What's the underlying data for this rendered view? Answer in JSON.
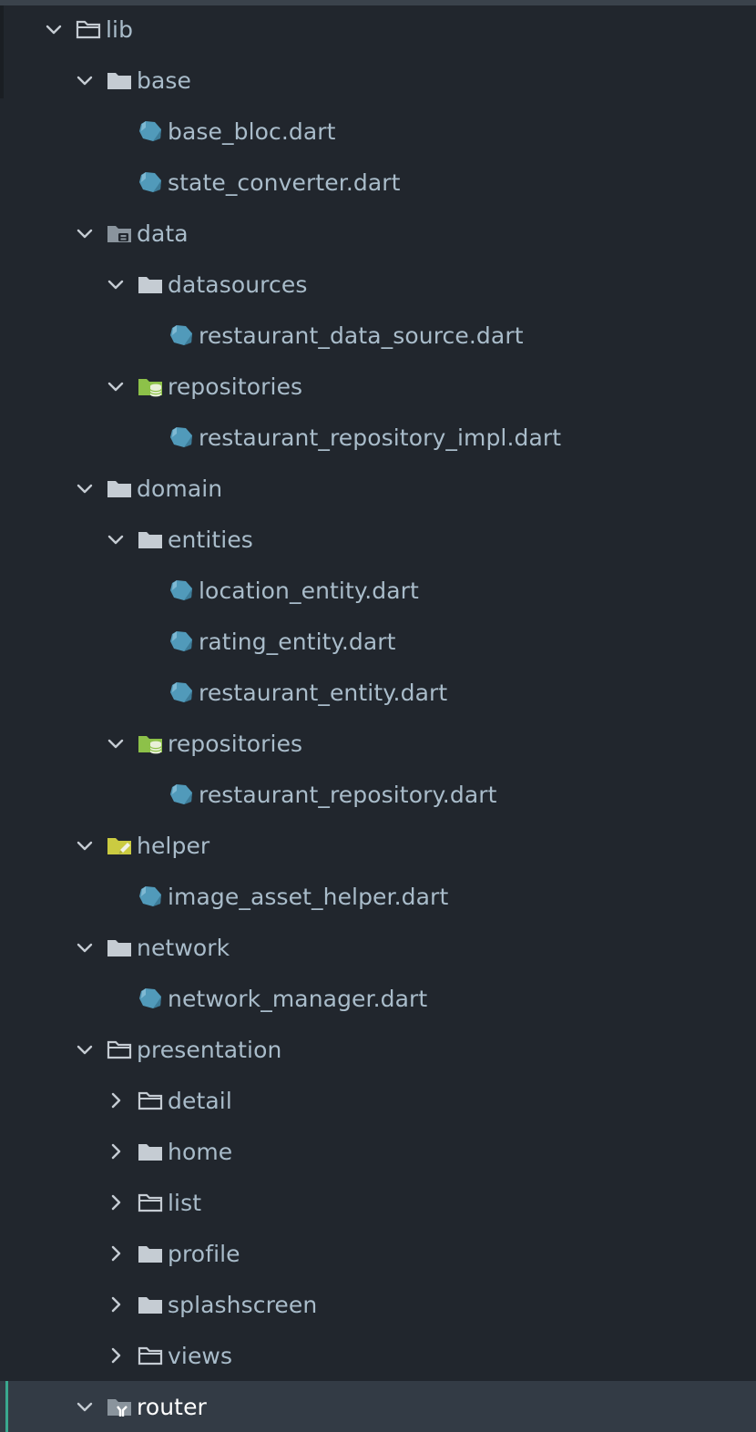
{
  "tree": [
    {
      "label": "lib",
      "depth": 0,
      "kind": "folder-outline",
      "expanded": true,
      "name": "tree-item-lib"
    },
    {
      "label": "base",
      "depth": 1,
      "kind": "folder",
      "expanded": true,
      "name": "tree-item-base"
    },
    {
      "label": "base_bloc.dart",
      "depth": 2,
      "kind": "dart-file",
      "name": "tree-item-base-bloc"
    },
    {
      "label": "state_converter.dart",
      "depth": 2,
      "kind": "dart-file",
      "name": "tree-item-state-converter"
    },
    {
      "label": "data",
      "depth": 1,
      "kind": "folder-data",
      "expanded": true,
      "name": "tree-item-data"
    },
    {
      "label": "datasources",
      "depth": 2,
      "kind": "folder",
      "expanded": true,
      "name": "tree-item-datasources"
    },
    {
      "label": "restaurant_data_source.dart",
      "depth": 3,
      "kind": "dart-file",
      "name": "tree-item-restaurant-data-source"
    },
    {
      "label": "repositories",
      "depth": 2,
      "kind": "folder-db",
      "expanded": true,
      "name": "tree-item-data-repositories"
    },
    {
      "label": "restaurant_repository_impl.dart",
      "depth": 3,
      "kind": "dart-file",
      "name": "tree-item-restaurant-repository-impl"
    },
    {
      "label": "domain",
      "depth": 1,
      "kind": "folder",
      "expanded": true,
      "name": "tree-item-domain"
    },
    {
      "label": "entities",
      "depth": 2,
      "kind": "folder",
      "expanded": true,
      "name": "tree-item-entities"
    },
    {
      "label": "location_entity.dart",
      "depth": 3,
      "kind": "dart-file",
      "name": "tree-item-location-entity"
    },
    {
      "label": "rating_entity.dart",
      "depth": 3,
      "kind": "dart-file",
      "name": "tree-item-rating-entity"
    },
    {
      "label": "restaurant_entity.dart",
      "depth": 3,
      "kind": "dart-file",
      "name": "tree-item-restaurant-entity"
    },
    {
      "label": "repositories",
      "depth": 2,
      "kind": "folder-db",
      "expanded": true,
      "name": "tree-item-domain-repositories"
    },
    {
      "label": "restaurant_repository.dart",
      "depth": 3,
      "kind": "dart-file",
      "name": "tree-item-restaurant-repository"
    },
    {
      "label": "helper",
      "depth": 1,
      "kind": "folder-helper",
      "expanded": true,
      "name": "tree-item-helper"
    },
    {
      "label": "image_asset_helper.dart",
      "depth": 2,
      "kind": "dart-file",
      "name": "tree-item-image-asset-helper"
    },
    {
      "label": "network",
      "depth": 1,
      "kind": "folder",
      "expanded": true,
      "name": "tree-item-network"
    },
    {
      "label": "network_manager.dart",
      "depth": 2,
      "kind": "dart-file",
      "name": "tree-item-network-manager"
    },
    {
      "label": "presentation",
      "depth": 1,
      "kind": "folder-outline",
      "expanded": true,
      "name": "tree-item-presentation"
    },
    {
      "label": "detail",
      "depth": 2,
      "kind": "folder-outline",
      "expanded": false,
      "name": "tree-item-detail"
    },
    {
      "label": "home",
      "depth": 2,
      "kind": "folder",
      "expanded": false,
      "name": "tree-item-home"
    },
    {
      "label": "list",
      "depth": 2,
      "kind": "folder-outline",
      "expanded": false,
      "name": "tree-item-list"
    },
    {
      "label": "profile",
      "depth": 2,
      "kind": "folder",
      "expanded": false,
      "name": "tree-item-profile"
    },
    {
      "label": "splashscreen",
      "depth": 2,
      "kind": "folder",
      "expanded": false,
      "name": "tree-item-splashscreen"
    },
    {
      "label": "views",
      "depth": 2,
      "kind": "folder-outline",
      "expanded": false,
      "name": "tree-item-views"
    },
    {
      "label": "router",
      "depth": 1,
      "kind": "folder-router",
      "expanded": true,
      "selected": true,
      "name": "tree-item-router"
    }
  ],
  "colors": {
    "background": "#21262d",
    "text": "#a9bcca",
    "folder": "#c5ccd3",
    "folder_db": "#8dc149",
    "folder_helper": "#cbcb41",
    "dart": "#519aba",
    "selected_bg": "#333b45",
    "selected_accent": "#3aa88f"
  }
}
